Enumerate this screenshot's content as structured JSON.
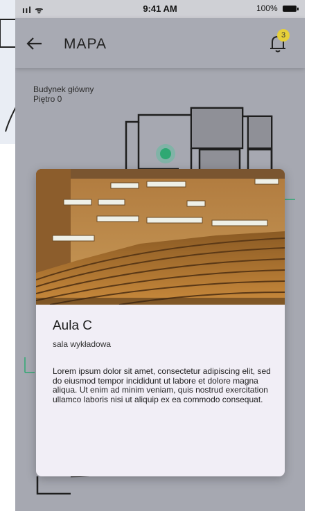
{
  "status_bar": {
    "signal_text": "ııl ᯤ",
    "time": "9:41 AM",
    "battery_percent": "100%"
  },
  "app_bar": {
    "title": "MAPA",
    "back_icon": "arrow-left-icon",
    "notification_icon": "bell-icon",
    "notification_count": "3",
    "badge_color": "#e6d03a"
  },
  "map": {
    "building": "Budynek główny",
    "floor": "Piętro 0",
    "pin_color": "#2fa873"
  },
  "room_card": {
    "name": "Aula C",
    "type": "sala wykładowa",
    "description": "Lorem ipsum dolor sit amet, consectetur adipiscing elit, sed do eiusmod tempor incididunt ut labore et dolore magna aliqua. Ut enim ad minim veniam, quis nostrud exercitation ullamco laboris nisi ut aliquip ex ea commodo consequat."
  }
}
